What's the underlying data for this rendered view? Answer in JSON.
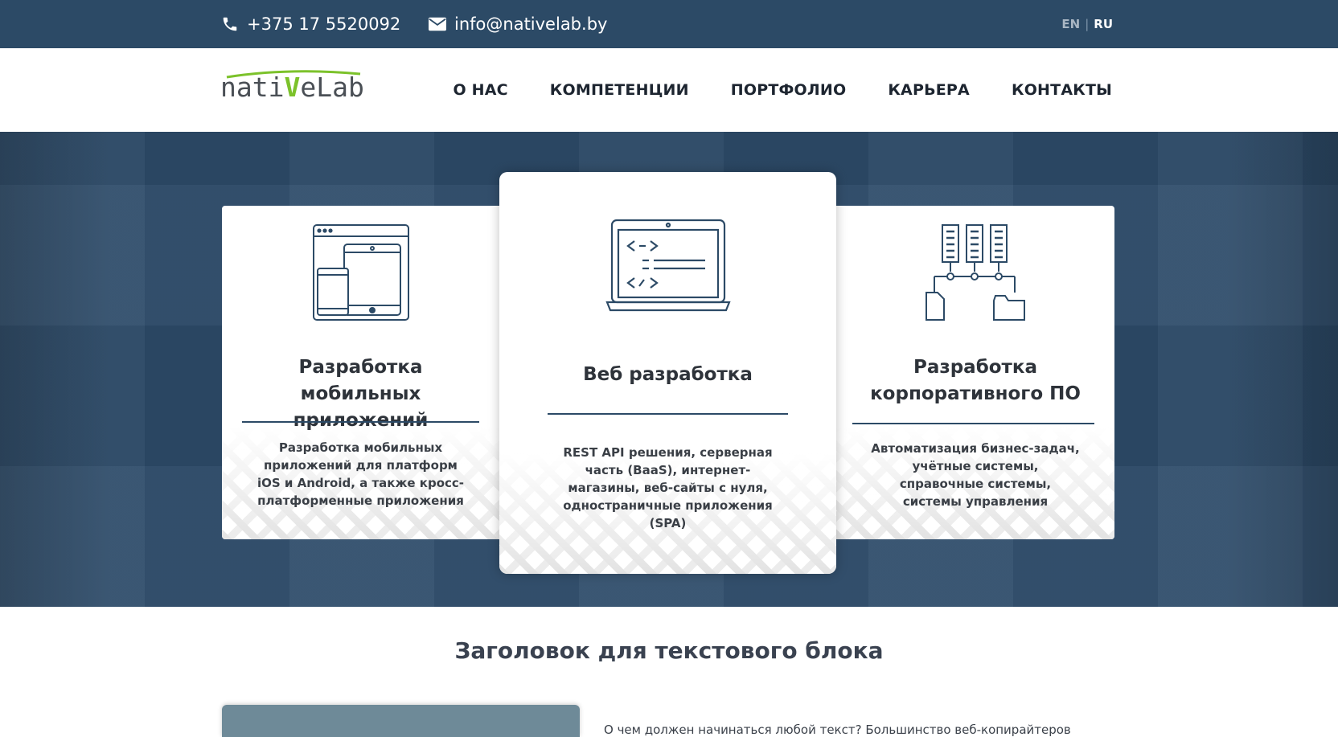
{
  "topbar": {
    "phone": "+375 17 5520092",
    "email": "info@nativelab.by",
    "lang_en": "EN",
    "lang_sep": "|",
    "lang_ru": "RU",
    "icons": {
      "phone": "phone-icon",
      "email": "envelope-icon"
    }
  },
  "logo": {
    "part1": "nati",
    "v": "V",
    "part2": "eLab"
  },
  "nav": [
    {
      "label": "О НАС"
    },
    {
      "label": "КОМПЕТЕНЦИИ"
    },
    {
      "label": "ПОРТФОЛИО"
    },
    {
      "label": "КАРЬЕРА"
    },
    {
      "label": "КОНТАКТЫ"
    }
  ],
  "cards": [
    {
      "icon": "devices-icon",
      "title": "Разработка мобильных приложений",
      "text": "Разработка мобильных приложений для платформ iOS и Android, а также кросс-платформенные приложения"
    },
    {
      "icon": "laptop-code-icon",
      "title": "Веб разработка",
      "text": "REST API решения, серверная часть (BaaS), интернет-магазины, веб-сайты с нуля, одностраничные приложения (SPA)"
    },
    {
      "icon": "servers-icon",
      "title": "Разработка корпоративного ПО",
      "text": "Автоматизация бизнес-задач, учётные системы, справочные системы, системы управления"
    }
  ],
  "section": {
    "title": "Заголовок для текстового блока",
    "text": "О чем должен начинаться любой текст? Большинство веб-копирайтеров"
  },
  "colors": {
    "topbar": "#2c4a66",
    "hero": "#2d4b69",
    "logo_accent": "#7cc22b",
    "rule": "#2c4a66"
  }
}
